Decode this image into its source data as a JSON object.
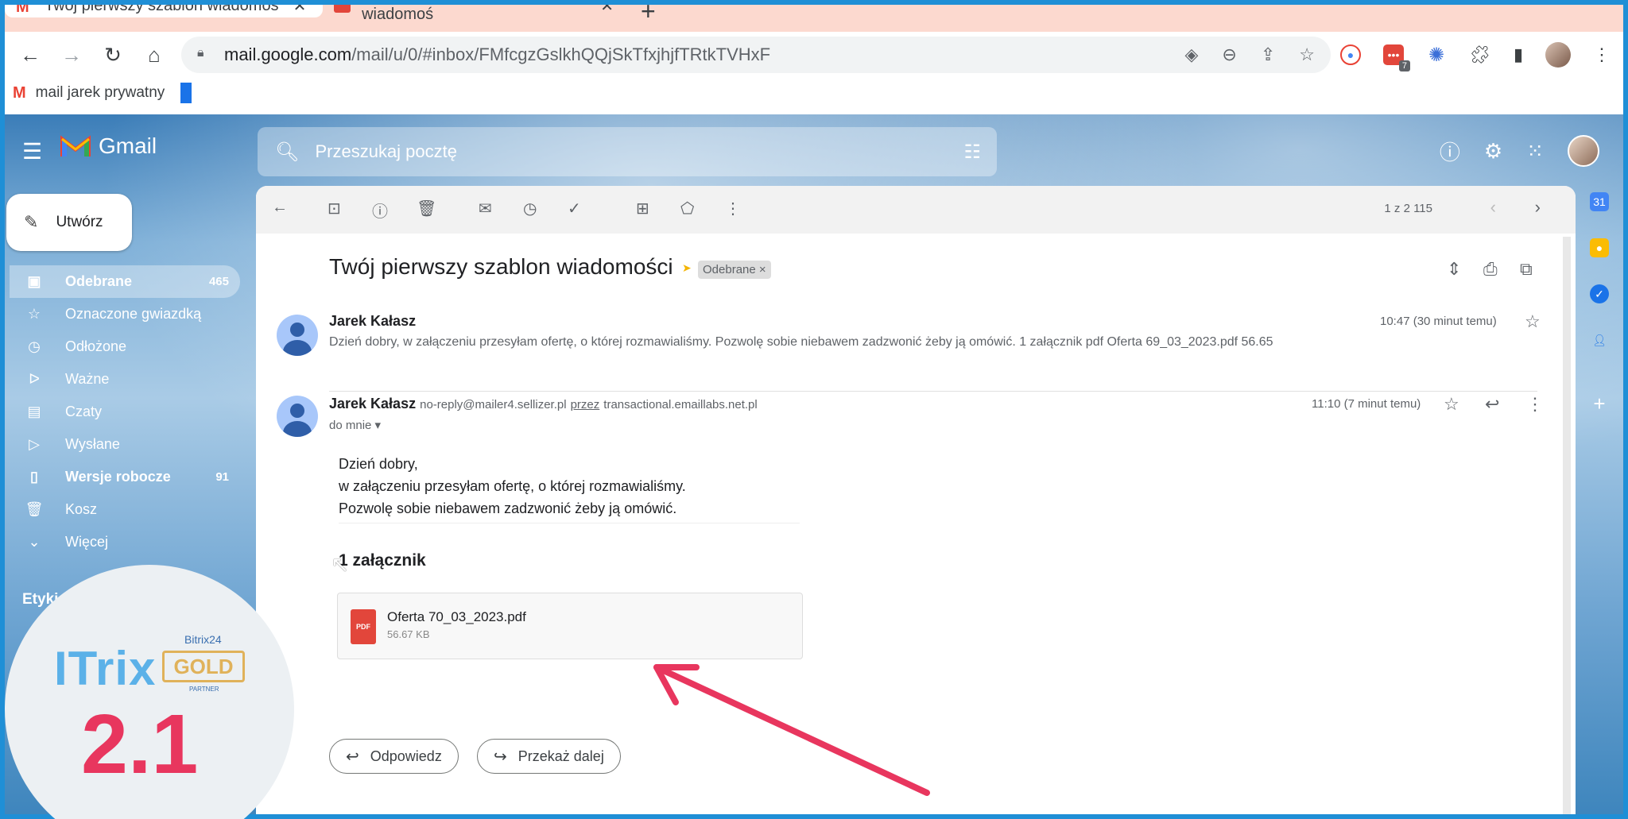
{
  "browser": {
    "tabs": [
      {
        "title": "Twój pierwszy szablon wiadomoś"
      },
      {
        "title": "Twój pierwszy szablon wiadomoś"
      }
    ],
    "url_prefix": "mail.google.com",
    "url_rest": "/mail/u/0/#inbox/FMfcgzGslkhQQjSkTfxjhjfTRtkTVHxF",
    "extension_badge": "7",
    "bookmark": "mail jarek prywatny"
  },
  "gmail": {
    "logo_text": "Gmail",
    "search_placeholder": "Przeszukaj pocztę",
    "compose_label": "Utwórz",
    "nav": [
      {
        "icon": "inbox-icon",
        "label": "Odebrane",
        "count": "465"
      },
      {
        "icon": "star-icon",
        "label": "Oznaczone gwiazdką",
        "count": ""
      },
      {
        "icon": "clock-icon",
        "label": "Odłożone",
        "count": ""
      },
      {
        "icon": "important-icon",
        "label": "Ważne",
        "count": ""
      },
      {
        "icon": "chat-icon",
        "label": "Czaty",
        "count": ""
      },
      {
        "icon": "send-icon",
        "label": "Wysłane",
        "count": ""
      },
      {
        "icon": "draft-icon",
        "label": "Wersje robocze",
        "count": "91"
      },
      {
        "icon": "trash-icon",
        "label": "Kosz",
        "count": ""
      },
      {
        "icon": "chevron-down-icon",
        "label": "Więcej",
        "count": ""
      }
    ],
    "labels_heading": "Etykiet",
    "pager": "1 z 2 115",
    "subject": "Twój pierwszy szablon wiadomości",
    "subject_tag": "Odebrane ×",
    "messages": [
      {
        "sender": "Jarek Kałasz",
        "snippet": "Dzień dobry, w załączeniu przesyłam ofertę, o której rozmawialiśmy. Pozwolę sobie niebawem zadzwonić żeby ją omówić. 1 załącznik pdf Oferta 69_03_2023.pdf 56.65",
        "time": "10:47 (30 minut temu)"
      },
      {
        "sender": "Jarek Kałasz",
        "email": "no-reply@mailer4.sellizer.pl",
        "via_label": "przez",
        "via_domain": "transactional.emaillabs.net.pl",
        "to": "do mnie",
        "time": "11:10 (7 minut temu)",
        "body": [
          "Dzień dobry,",
          "w załączeniu przesyłam ofertę, o której rozmawialiśmy.",
          "Pozwolę sobie niebawem zadzwonić żeby ją omówić."
        ],
        "attachments_heading": "1 załącznik",
        "attachment": {
          "name": "Oferta 70_03_2023.pdf",
          "size": "56.67 KB",
          "type_label": "PDF"
        }
      }
    ],
    "reply_label": "Odpowiedz",
    "forward_label": "Przekaż dalej"
  },
  "overlay": {
    "brand": "ITrix",
    "partner_top": "Bitrix24",
    "partner_tier": "GOLD",
    "partner_bottom": "PARTNER",
    "version": "2.1",
    "arrow_color": "#e8365e"
  }
}
